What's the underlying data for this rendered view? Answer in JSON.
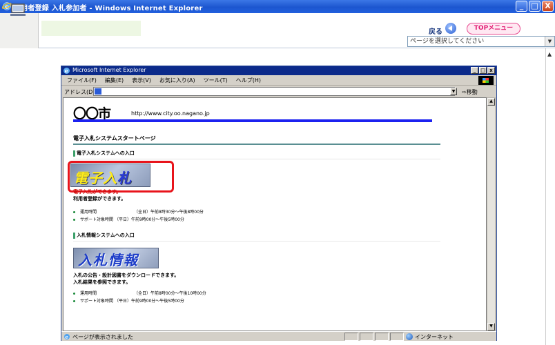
{
  "outer_window": {
    "title": "利用者登録 入札参加者 - Windows Internet Explorer",
    "controls": {
      "minimize": "_",
      "maximize": "□",
      "close": "X"
    }
  },
  "outer_toolbar": {
    "back_label": "戻る",
    "top_menu_label": "TOPメニュー",
    "page_select_value": "ページを選択してください"
  },
  "inner_window": {
    "title": "Microsoft Internet Explorer",
    "menu": [
      "ファイル(F)",
      "編集(E)",
      "表示(V)",
      "お気に入り(A)",
      "ツール(T)",
      "ヘルプ(H)"
    ],
    "address_label": "アドレス(D)",
    "go_label": "移動",
    "status_text": "ページが表示されました",
    "zone_text": "インターネット"
  },
  "page": {
    "logo_text": "〇〇市",
    "site_url": "http://www.city.oo.nagano.jp",
    "heading": "電子入札システムスタートページ",
    "section1": {
      "title": "電子入札システムへの入口",
      "banner_text_a": "電子入",
      "banner_text_b": "札",
      "line_red": "電子入札ができます。",
      "line": "利用者登録ができます。",
      "bullets": [
        {
          "label": "運用時間",
          "value": "（全日）午前8時30分～午後8時00分"
        },
        {
          "label": "サポート対象時間",
          "value": "（平日）午前9時00分～午後5時00分"
        }
      ]
    },
    "section2": {
      "title": "入札情報システムへの入口",
      "banner_text": "入札情報",
      "line1": "入札の公告・設計図書をダウンロードできます。",
      "line2": "入札結果を参照できます。",
      "bullets": [
        {
          "label": "運用時間",
          "value": "（全日）午前8時00分～午後10時00分"
        },
        {
          "label": "サポート対象時間",
          "value": "（平日）午前9時00分～午後5時00分"
        }
      ]
    }
  },
  "colors": {
    "xp_title": "#1c56cf",
    "inner_title": "#0b2a8a",
    "logo_underline": "#1c22f0",
    "highlight_frame": "#e8141b",
    "top_menu_text": "#e01d72"
  }
}
